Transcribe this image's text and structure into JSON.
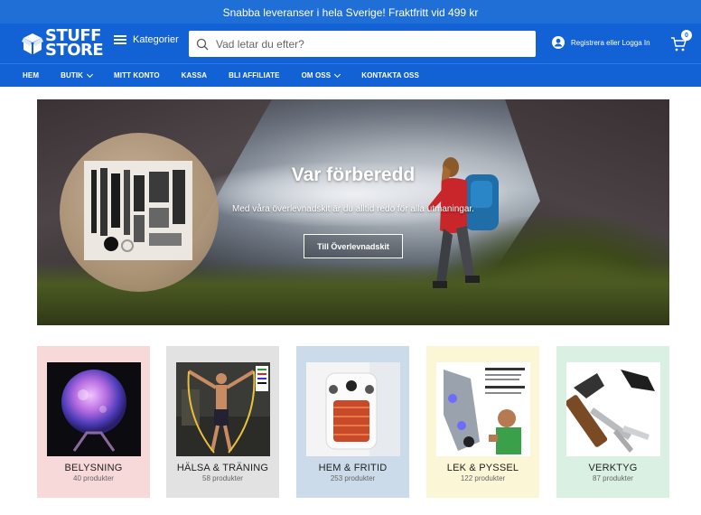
{
  "promo": {
    "text": "Snabba leveranser i hela Sverige! Fraktfritt vid 499 kr"
  },
  "header": {
    "logo_line1": "STUFF",
    "logo_line2": "STORE",
    "categories_label": "Kategorier",
    "search_placeholder": "Vad letar du efter?",
    "account_label": "Registrera eller Logga In",
    "cart_count": "0"
  },
  "nav": {
    "items": [
      {
        "label": "HEM",
        "dropdown": false
      },
      {
        "label": "BUTIK",
        "dropdown": true
      },
      {
        "label": "MITT KONTO",
        "dropdown": false
      },
      {
        "label": "KASSA",
        "dropdown": false
      },
      {
        "label": "BLI AFFILIATE",
        "dropdown": false
      },
      {
        "label": "OM OSS",
        "dropdown": true
      },
      {
        "label": "KONTAKTA OSS",
        "dropdown": false
      }
    ]
  },
  "hero": {
    "title": "Var förberedd",
    "subtitle": "Med våra överlevnadskit är du alltid redo för alla utmaningar.",
    "button_label": "Till Överlevnadskit"
  },
  "categories": [
    {
      "name": "BELYSNING",
      "count": "40 produkter",
      "bg": "#f8d9d9"
    },
    {
      "name": "HÄLSA & TRÄNING",
      "count": "58 produkter",
      "bg": "#e2e2e2"
    },
    {
      "name": "HEM & FRITID",
      "count": "253 produkter",
      "bg": "#cbdbe9"
    },
    {
      "name": "LEK & PYSSEL",
      "count": "122 produkter",
      "bg": "#fbf6d6"
    },
    {
      "name": "VERKTYG",
      "count": "87 produkter",
      "bg": "#d9f0e2"
    }
  ],
  "colors": {
    "brand": "#1262d6",
    "promo": "#1f6fd6"
  }
}
